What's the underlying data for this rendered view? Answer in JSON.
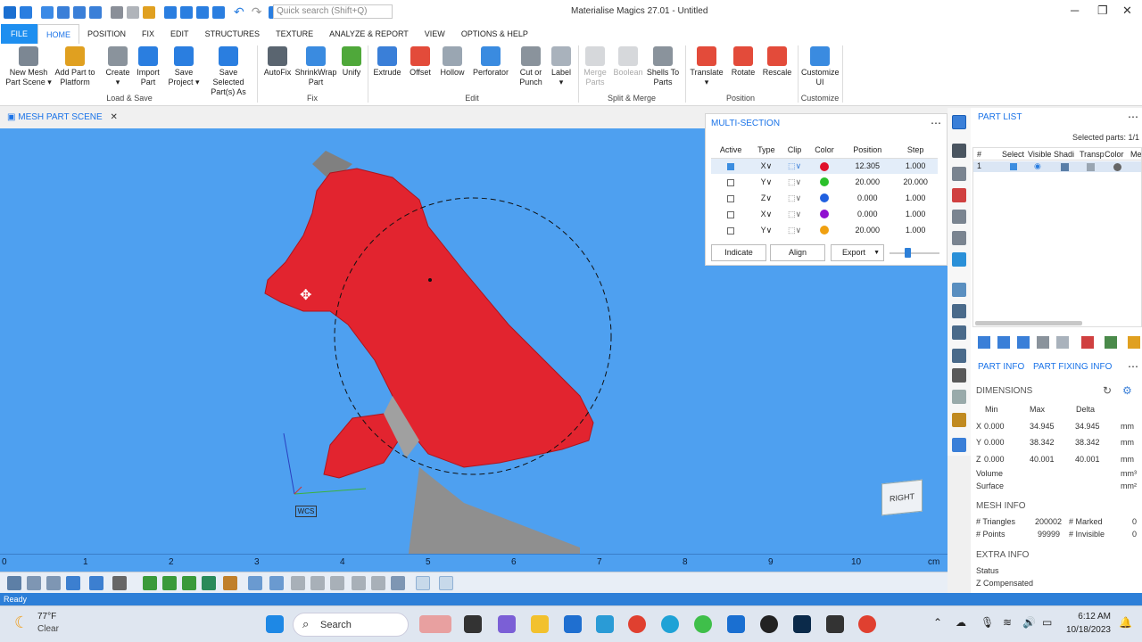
{
  "app": {
    "title": "Materialise Magics 27.01 - Untitled",
    "search_placeholder": "Quick search (Shift+Q)"
  },
  "tabs": [
    "FILE",
    "HOME",
    "POSITION",
    "FIX",
    "EDIT",
    "STRUCTURES",
    "TEXTURE",
    "ANALYZE & REPORT",
    "VIEW",
    "OPTIONS & HELP"
  ],
  "ribbon": {
    "new_mesh": "New Mesh",
    "new_mesh2": "Part Scene ▾",
    "add_part": "Add Part to",
    "add_part2": "Platform",
    "create": "Create",
    "create2": "▾",
    "import_part": "Import",
    "import_part2": "Part",
    "save_project": "Save",
    "save_project2": "Project ▾",
    "save_selected": "Save Selected",
    "save_selected2": "Part(s) As",
    "autofix": "AutoFix",
    "shrinkwrap": "ShrinkWrap",
    "shrinkwrap2": "Part",
    "unify": "Unify",
    "extrude": "Extrude",
    "offset": "Offset",
    "hollow": "Hollow",
    "perforator": "Perforator",
    "cut_punch": "Cut or",
    "cut_punch2": "Punch",
    "label": "Label",
    "label2": "▾",
    "merge_parts": "Merge",
    "merge_parts2": "Parts",
    "boolean": "Boolean",
    "shells_to_parts": "Shells To",
    "shells_to_parts2": "Parts",
    "translate": "Translate",
    "translate2": "▾",
    "rotate": "Rotate",
    "rescale": "Rescale",
    "customize_ui": "Customize",
    "customize_ui2": "UI",
    "groups": {
      "load_save": "Load & Save",
      "fix": "Fix",
      "edit": "Edit",
      "split_merge": "Split & Merge",
      "position": "Position",
      "customize": "Customize"
    }
  },
  "scene": {
    "tab_label": "MESH PART SCENE",
    "wcs_label": "WCS",
    "viewcube_label": "RIGHT",
    "ruler_ticks": [
      "0",
      "1",
      "2",
      "3",
      "4",
      "5",
      "6",
      "7",
      "8",
      "9",
      "10"
    ],
    "ruler_unit": "cm"
  },
  "multi_section": {
    "title": "MULTI-SECTION",
    "columns": [
      "Active",
      "Type",
      "Clip",
      "Color",
      "Position",
      "Step"
    ],
    "rows": [
      {
        "active": true,
        "type": "X∨",
        "color": "#e0102a",
        "position": "12.305",
        "step": "1.000"
      },
      {
        "active": false,
        "type": "Y∨",
        "color": "#2bc02b",
        "position": "20.000",
        "step": "20.000"
      },
      {
        "active": false,
        "type": "Z∨",
        "color": "#2060e0",
        "position": "0.000",
        "step": "1.000"
      },
      {
        "active": false,
        "type": "X∨",
        "color": "#9010d0",
        "position": "0.000",
        "step": "1.000"
      },
      {
        "active": false,
        "type": "Y∨",
        "color": "#f0a010",
        "position": "20.000",
        "step": "1.000"
      }
    ],
    "buttons": {
      "indicate": "Indicate",
      "align": "Align",
      "export": "Export"
    },
    "slider_fraction": 0.36
  },
  "part_list": {
    "title": "PART LIST",
    "selected_parts": "Selected parts: 1/1",
    "columns": [
      "#",
      "Select",
      "Visible",
      "Shadi",
      "Transp",
      "Color",
      "Me"
    ],
    "row_index": "1"
  },
  "part_info": {
    "tab_info": "PART INFO",
    "tab_fixing": "PART FIXING INFO",
    "dimensions": "DIMENSIONS",
    "cols": [
      "Min",
      "Max",
      "Delta"
    ],
    "x": {
      "axis": "X",
      "min": "0.000",
      "max": "34.945",
      "delta": "34.945",
      "unit": "mm"
    },
    "y": {
      "axis": "Y",
      "min": "0.000",
      "max": "38.342",
      "delta": "38.342",
      "unit": "mm"
    },
    "z": {
      "axis": "Z",
      "min": "0.000",
      "max": "40.001",
      "delta": "40.001",
      "unit": "mm"
    },
    "volume": "Volume",
    "volume_unit": "mm³",
    "surface": "Surface",
    "surface_unit": "mm²",
    "mesh_info": "MESH INFO",
    "triangles_label": "# Triangles",
    "triangles": "200002",
    "marked_label": "# Marked",
    "marked": "0",
    "points_label": "# Points",
    "points": "99999",
    "invisible_label": "# Invisible",
    "invisible": "0",
    "extra_info": "EXTRA INFO",
    "status_label": "Status",
    "z_comp_label": "Z Compensated"
  },
  "status_bar": "Ready",
  "taskbar": {
    "temp": "77°F",
    "weather": "Clear",
    "search": "Search",
    "time": "6:12 AM",
    "date": "10/18/2023"
  },
  "colors": {
    "viewport": "#4ea0f0",
    "accent": "#1a73e8",
    "part": "#e2242f"
  }
}
